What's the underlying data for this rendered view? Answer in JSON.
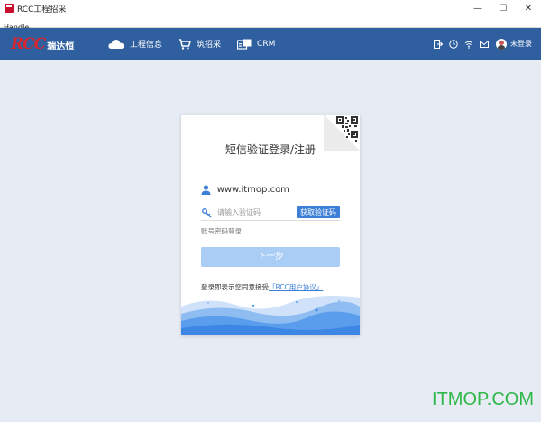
{
  "window": {
    "title": "RCC工程招采",
    "controls": {
      "minimize": "—",
      "maximize": "☐",
      "close": "✕"
    }
  },
  "menubar": {
    "items": [
      {
        "label": "Handle"
      }
    ]
  },
  "navbar": {
    "logo": {
      "mark": "RCC",
      "text": "瑞达恒"
    },
    "items": [
      {
        "label": "工程信息",
        "icon": "cloud-icon"
      },
      {
        "label": "筑招采",
        "icon": "cart-icon"
      },
      {
        "label": "CRM",
        "icon": "crm-icon"
      }
    ],
    "right": {
      "login_state": "未登录"
    }
  },
  "login_card": {
    "title": "短信验证登录/注册",
    "phone_value": "www.itmop.com",
    "code_placeholder": "请输入验证码",
    "get_code_label": "获取验证码",
    "switch_label": "账号密码登录",
    "next_label": "下一步",
    "agree_text": "登录即表示您同意接受",
    "agree_link": "「RCC用户协议」"
  },
  "watermark": "ITMOP.COM",
  "colors": {
    "nav": "#2f5f9f",
    "accent": "#3d7fd6",
    "button_disabled": "#a9cdf5",
    "watermark": "#2fb84a"
  }
}
